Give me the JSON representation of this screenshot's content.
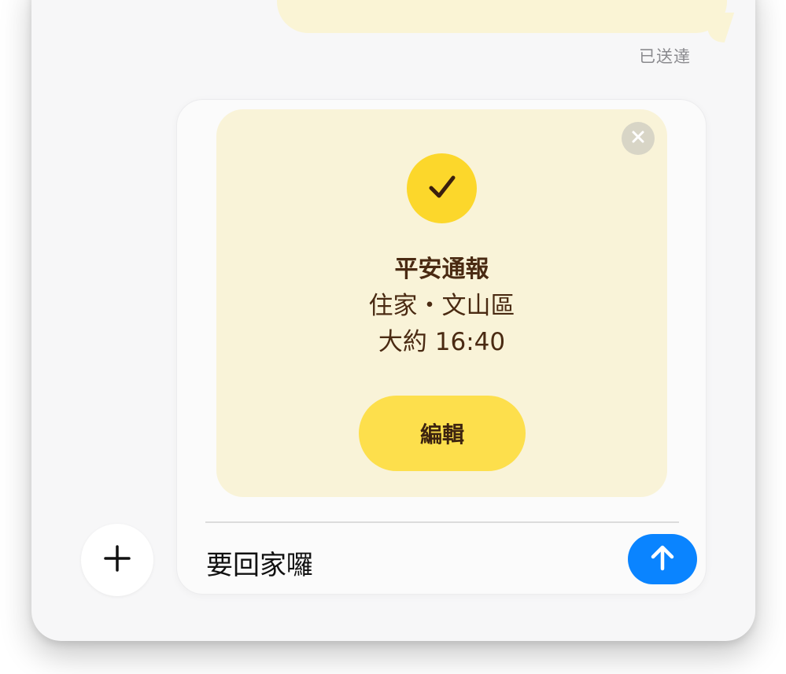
{
  "conversation": {
    "status": "已送達"
  },
  "compose": {
    "card": {
      "title": "平安通報",
      "location": "住家・文山區",
      "time": "大約 16:40",
      "edit_label": "編輯",
      "close_icon": "close-icon",
      "check_icon": "checkmark-icon"
    },
    "input_value": "要回家囉",
    "send_icon": "arrow-up-icon"
  },
  "plus_icon": "plus-icon",
  "colors": {
    "card_background": "#f9f3d8",
    "accent_yellow": "#fcd72b",
    "button_yellow": "#fddf4c",
    "send_blue": "#0a84ff",
    "text_brown": "#4a2a12"
  }
}
